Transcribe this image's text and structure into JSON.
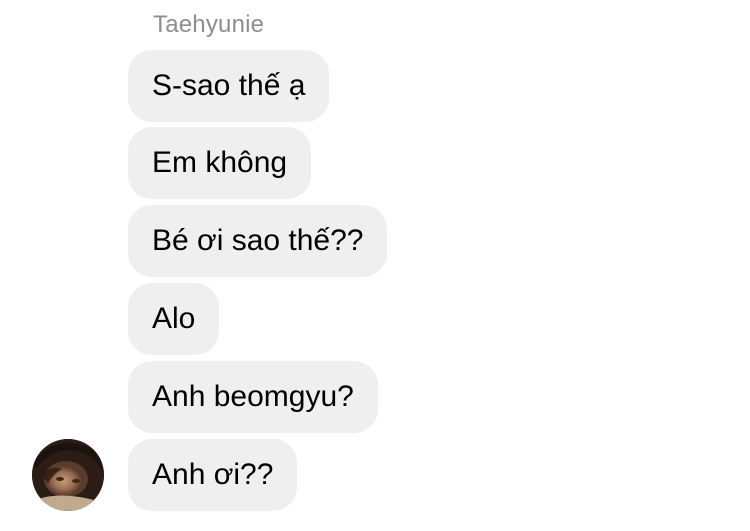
{
  "thread": {
    "sender_name": "Taehyunie",
    "messages": [
      "S-sao thế ạ",
      "Em không",
      "Bé ơi sao thế??",
      "Alo",
      "Anh beomgyu?",
      "Anh ơi??"
    ]
  },
  "colors": {
    "bubble": "#efefef",
    "sender_name": "#8e8e8e",
    "text": "#000000",
    "background": "#ffffff"
  },
  "icons": {
    "avatar": "sender-avatar-photo"
  }
}
